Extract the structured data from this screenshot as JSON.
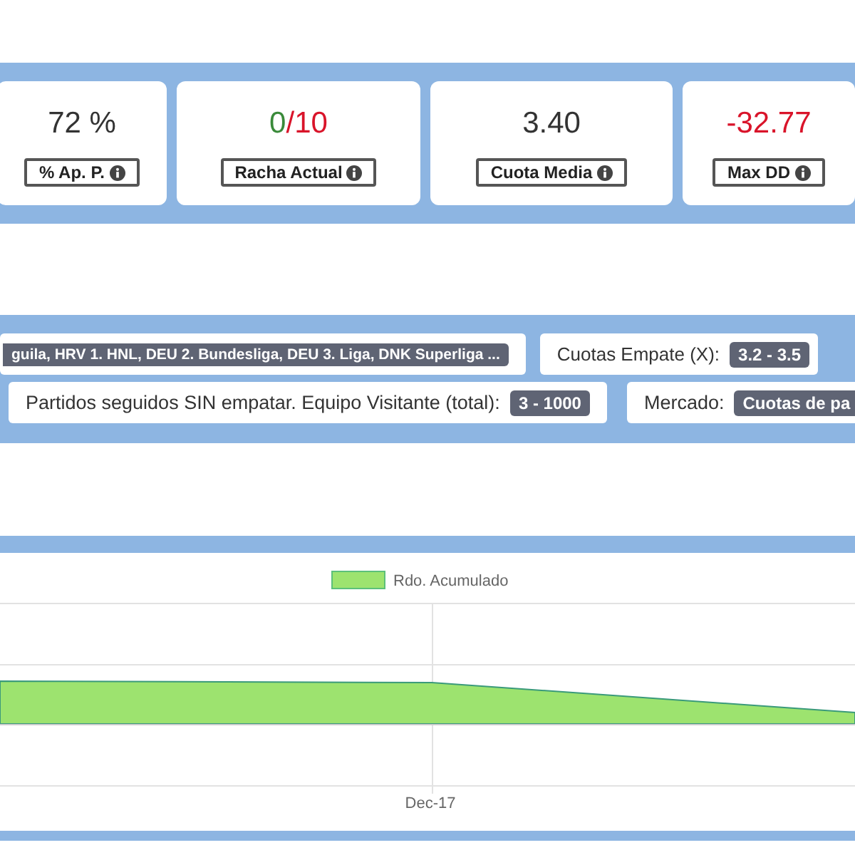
{
  "stats": [
    {
      "value": [
        {
          "text": "72 %",
          "color": "#333333"
        }
      ],
      "label": "% Ap. P."
    },
    {
      "value": [
        {
          "text": "0",
          "color": "#3a8a3a"
        },
        {
          "text": "/10",
          "color": "#d9142a"
        }
      ],
      "label": "Racha Actual"
    },
    {
      "value": [
        {
          "text": "3.40",
          "color": "#333333"
        }
      ],
      "label": "Cuota Media"
    },
    {
      "value": [
        {
          "text": "-32.77",
          "color": "#d9142a"
        }
      ],
      "label": "Max DD"
    }
  ],
  "filters": [
    [
      {
        "value": "guila, HRV 1. HNL, DEU 2. Bundesliga, DEU 3. Liga, DNK Superliga ..."
      },
      {
        "label": "Cuotas Empate (X):",
        "value": "3.2 - 3.5"
      }
    ],
    [
      {
        "label": "Partidos seguidos SIN empatar. Equipo Visitante (total):",
        "value": "3 - 1000"
      },
      {
        "label": "Mercado:",
        "value": "Cuotas de pa"
      }
    ]
  ],
  "chart": {
    "legend": "Rdo. Acumulado",
    "x_label": "Dec-17"
  }
}
